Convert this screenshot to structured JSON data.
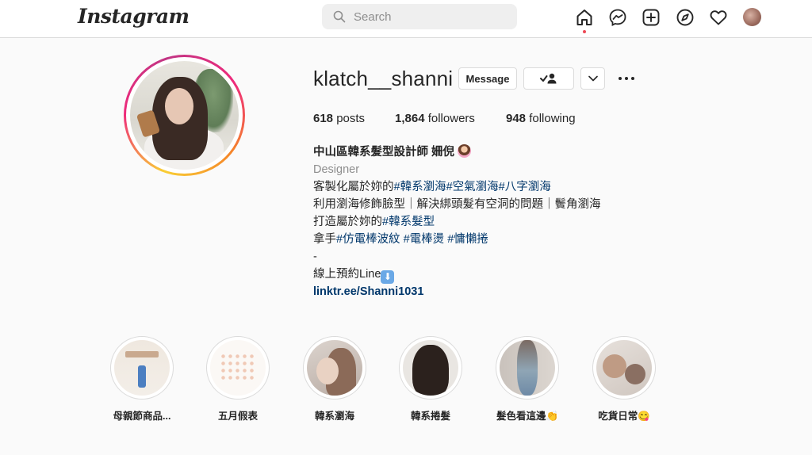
{
  "nav": {
    "logo": "Instagram",
    "search_placeholder": "Search",
    "icons": [
      "home-icon",
      "messenger-icon",
      "new-post-icon",
      "explore-icon",
      "activity-heart-icon",
      "profile-avatar"
    ]
  },
  "profile": {
    "username": "klatch__shanni",
    "message_label": "Message",
    "posts_count": "618",
    "posts_label": " posts",
    "followers_count": "1,864",
    "followers_label": " followers",
    "following_count": "948",
    "following_label": " following"
  },
  "bio": {
    "full_name": "中山區韓系髮型設計師 姍倪",
    "category": "Designer",
    "line1_text": "客製化屬於妳的",
    "line1_tags": [
      "#韓系瀏海",
      "#空氣瀏海",
      "#八字瀏海"
    ],
    "line2": "利用瀏海修飾臉型｜解決綁頭髮有空洞的問題｜鬢角瀏海",
    "line3_text": "打造屬於妳的",
    "line3_tag": "#韓系髮型",
    "line4_text": "拿手",
    "line4_tags": [
      "#仿電棒波紋",
      " #電棒燙",
      " #慵懶捲"
    ],
    "line5": "-",
    "line6": "線上預約Line",
    "link": "linktr.ee/Shanni1031"
  },
  "highlights": [
    {
      "label": "母親節商品..."
    },
    {
      "label": "五月假表"
    },
    {
      "label": "韓系瀏海"
    },
    {
      "label": "韓系捲髮"
    },
    {
      "label": "髮色看這邊👏"
    },
    {
      "label": "吃貨日常😋"
    }
  ],
  "colors": {
    "accent_link": "#00376b",
    "notification_dot": "#ed4956",
    "border": "#dbdbdb",
    "secondary_text": "#8e8e8e"
  }
}
